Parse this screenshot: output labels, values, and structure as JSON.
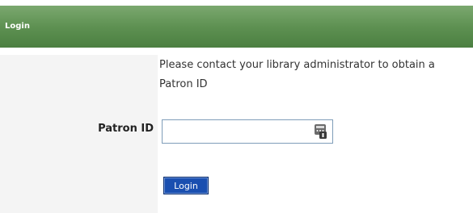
{
  "header": {
    "title": "Login"
  },
  "form": {
    "instructions": "Please contact your library administrator to obtain a Patron ID",
    "patron_id_label": "Patron ID",
    "patron_id_value": "",
    "patron_id_placeholder": "",
    "login_label": "Login",
    "keypad_icon": "keypad-icon"
  },
  "colors": {
    "header_green": "#5e9152",
    "button_blue": "#1a4fb0"
  }
}
